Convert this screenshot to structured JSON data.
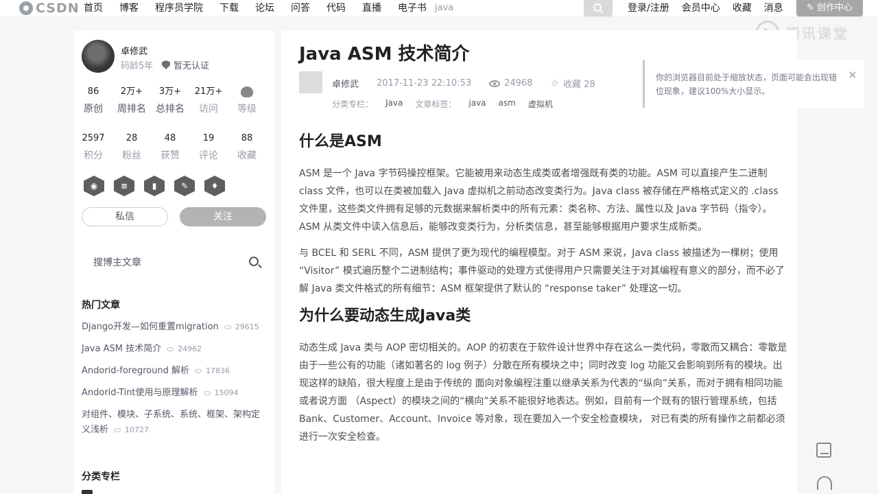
{
  "topbar": {
    "logo_text": "CSDN",
    "nav": [
      "首页",
      "博客",
      "程序员学院",
      "下载",
      "论坛",
      "问答",
      "代码",
      "直播",
      "电子书"
    ],
    "search_value": "java",
    "right_nav": [
      "登录/注册",
      "会员中心",
      "收藏",
      "消息"
    ],
    "create_label": "创作中心"
  },
  "watermark": {
    "text": "腾讯课堂"
  },
  "profile": {
    "name": "卓修武",
    "code_age": "码龄5年",
    "cert": "暂无认证",
    "stats_row1": [
      {
        "num": "86",
        "label": "原创"
      },
      {
        "num": "2万+",
        "label": "周排名"
      },
      {
        "num": "3万+",
        "label": "总排名"
      },
      {
        "num": "21万+",
        "label": "访问"
      },
      {
        "num": "",
        "label": "等级"
      }
    ],
    "stats_row2": [
      {
        "num": "2597",
        "label": "积分"
      },
      {
        "num": "28",
        "label": "粉丝"
      },
      {
        "num": "48",
        "label": "获赞"
      },
      {
        "num": "19",
        "label": "评论"
      },
      {
        "num": "88",
        "label": "收藏"
      }
    ],
    "message_label": "私信",
    "follow_label": "关注"
  },
  "sidebar": {
    "search_placeholder": "搜博主文章",
    "hot_title": "热门文章",
    "hot_articles": [
      {
        "title": "Django开发—如何重置migration",
        "views": "29615"
      },
      {
        "title": "Java ASM 技术简介",
        "views": "24962"
      },
      {
        "title": "Andorid-foreground 解析",
        "views": "17836"
      },
      {
        "title": "Andorid-Tint使用与原理解析",
        "views": "15094"
      },
      {
        "title": "对组件、模块、子系统、系统、框架、架构定义浅析",
        "views": "10727"
      }
    ],
    "category_title": "分类专栏"
  },
  "article": {
    "title": "Java ASM 技术简介",
    "author": "卓修武",
    "datetime": "2017-11-23 22:10:53",
    "views": "24968",
    "favorites": "收藏 28",
    "category_label": "分类专栏：",
    "category": "Java",
    "tags_label": "文章标签：",
    "tags": [
      "java",
      "asm",
      "虚拟机"
    ],
    "h1": "什么是ASM",
    "p1": "ASM 是一个 Java 字节码操控框架。它能被用来动态生成类或者增强既有类的功能。ASM 可以直接产生二进制 class 文件，也可以在类被加载入 Java 虚拟机之前动态改变类行为。Java class 被存储在严格格式定义的 .class 文件里，这些类文件拥有足够的元数据来解析类中的所有元素：类名称、方法、属性以及 Java 字节码（指令）。ASM 从类文件中读入信息后，能够改变类行为，分析类信息，甚至能够根据用户要求生成新类。",
    "p2": "与 BCEL 和 SERL 不同，ASM 提供了更为现代的编程模型。对于 ASM 来说，Java class 被描述为一棵树；使用 “Visitor” 模式遍历整个二进制结构；事件驱动的处理方式使得用户只需要关注于对其编程有意义的部分，而不必了解 Java 类文件格式的所有细节：ASM 框架提供了默认的 “response taker” 处理这一切。",
    "h2": "为什么要动态生成Java类",
    "p3": "动态生成 Java 类与 AOP 密切相关的。AOP 的初衷在于软件设计世界中存在这么一类代码，零散而又耦合：零散是由于一些公有的功能（诸如著名的 log 例子）分散在所有模块之中；同时改变 log 功能又会影响到所有的模块。出现这样的缺陷，很大程度上是由于传统的 面向对象编程注重以继承关系为代表的“纵向”关系，而对于拥有相同功能或者说方面 （Aspect）的模块之间的“横向”关系不能很好地表达。例如，目前有一个既有的银行管理系统，包括 Bank、Customer、Account、Invoice 等对象，现在要加入一个安全检查模块， 对已有类的所有操作之前都必须进行一次安全检查。"
  },
  "notice": {
    "text": "你的浏览器目前处于缩放状态，页面可能会出现错位现象，建议100%大小显示。",
    "close": "×"
  }
}
